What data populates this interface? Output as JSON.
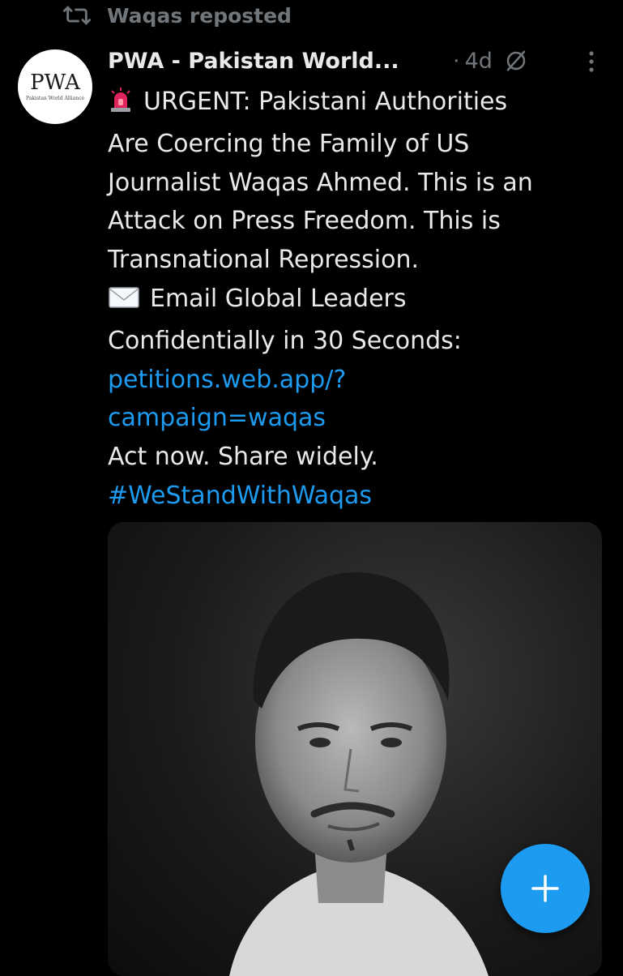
{
  "repost": {
    "icon": "repost-icon",
    "text": "Waqas reposted"
  },
  "author": {
    "avatar_logo": "PWA",
    "avatar_subtitle": "Pakistan World Alliance",
    "name": "PWA - Pakistan World...",
    "separator": "·",
    "timestamp": "4d",
    "audience_icon": "globe-slash-icon",
    "more_icon": "more-vertical-icon"
  },
  "post": {
    "urgent_emoji": "police-light-emoji",
    "lines": [
      "URGENT: Pakistani Authorities",
      "Are Coercing the Family of US",
      "Journalist Waqas Ahmed. This is an",
      "Attack on Press Freedom. This is",
      "Transnational Repression."
    ],
    "email_emoji": "envelope-emoji",
    "email_lines": [
      "Email Global Leaders",
      "Confidentially in 30 Seconds:"
    ],
    "link_lines": [
      "petitions.web.app/?",
      "campaign=waqas"
    ],
    "cta": "Act now. Share widely.",
    "hashtag": "#WeStandWithWaqas"
  },
  "media": {
    "type": "black-and-white portrait photo"
  },
  "fab": {
    "icon": "plus-icon"
  },
  "colors": {
    "background": "#000000",
    "text": "#e7e9ea",
    "muted": "#71767b",
    "accent": "#1d9bf0"
  }
}
